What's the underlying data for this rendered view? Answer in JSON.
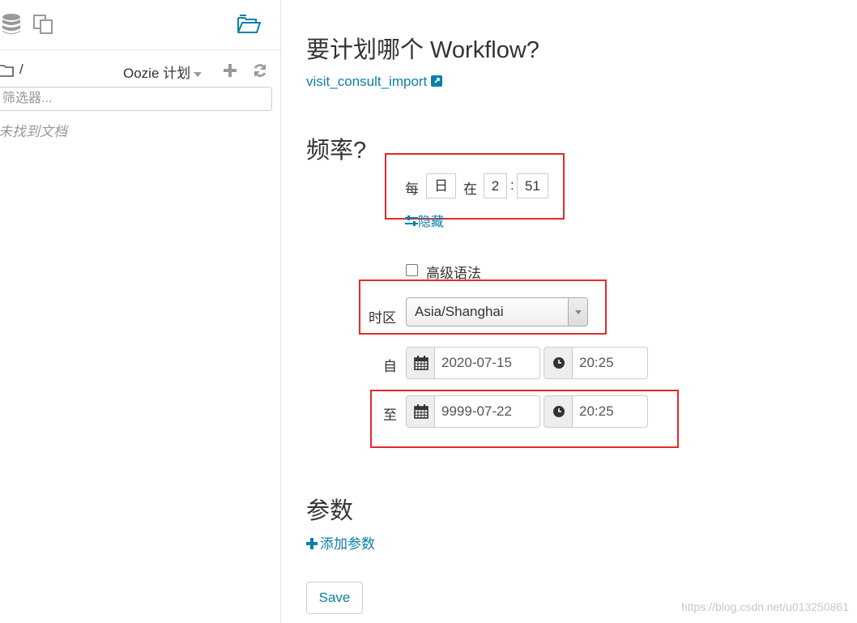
{
  "sidebar": {
    "path": "/",
    "doc_type": "Oozie 计划",
    "filter_placeholder": "筛选器...",
    "empty_text": "未找到文档"
  },
  "main": {
    "workflow_heading": "要计划哪个 Workflow?",
    "workflow_link": "visit_consult_import",
    "frequency_heading": "频率?",
    "frequency": {
      "every_label": "每",
      "period": "日",
      "at_label": "在",
      "hour": "2",
      "separator": ":",
      "minute": "51"
    },
    "hide_label": "隐藏",
    "advanced_syntax_label": "高级语法",
    "advanced_syntax_checked": false,
    "timezone_label": "时区",
    "timezone_value": "Asia/Shanghai",
    "start_label": "自",
    "start_date": "2020-07-15",
    "start_time": "20:25",
    "end_label": "至",
    "end_date": "9999-07-22",
    "end_time": "20:25",
    "params_heading": "参数",
    "add_param_label": "添加参数",
    "save_label": "Save"
  },
  "watermark": "https://blog.csdn.net/u013250861",
  "colors": {
    "accent": "#0b7fab",
    "highlight_box": "#e22a2a",
    "icon_gray": "#999999"
  }
}
